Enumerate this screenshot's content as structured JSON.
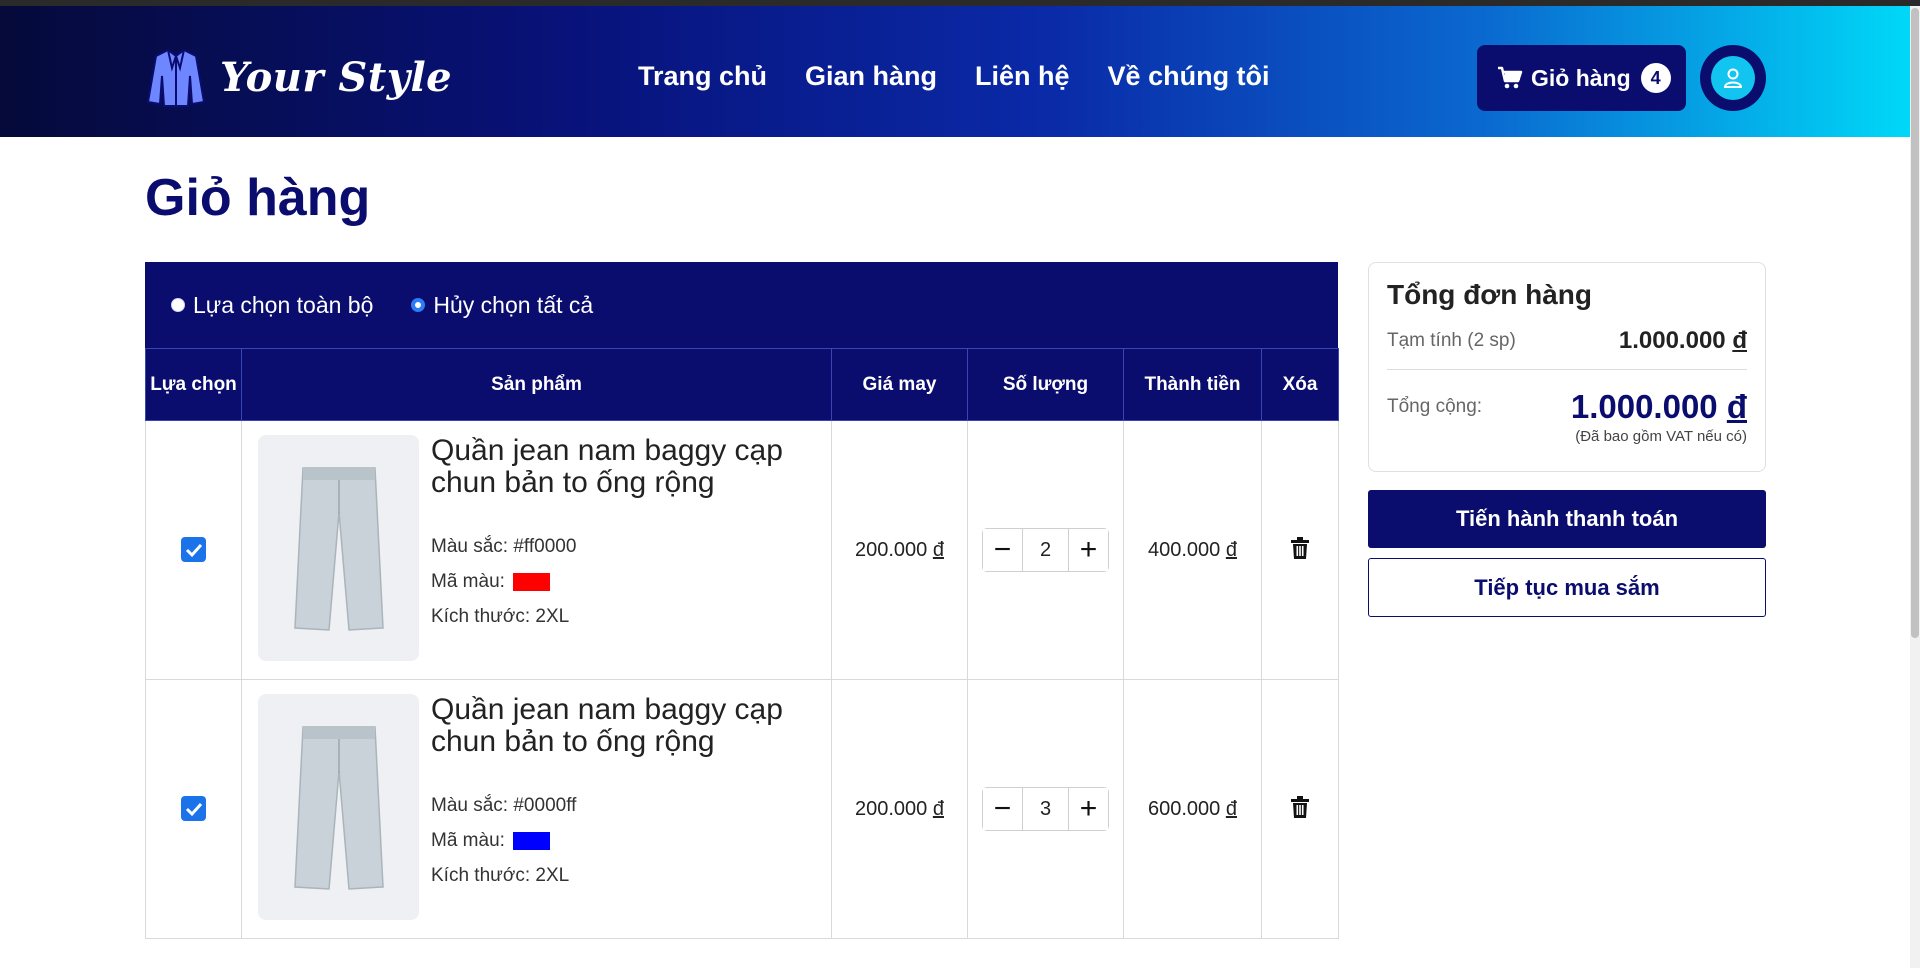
{
  "header": {
    "logo_text": "Your Style",
    "nav": [
      "Trang chủ",
      "Gian hàng",
      "Liên hệ",
      "Về chúng tôi"
    ],
    "cart_label": "Giỏ hàng",
    "cart_count": "4"
  },
  "page": {
    "title": "Giỏ hàng"
  },
  "selection": {
    "select_all": "Lựa chọn toàn bộ",
    "deselect_all": "Hủy chọn tất cả"
  },
  "table": {
    "headers": {
      "select": "Lựa chọn",
      "product": "Sản phẩm",
      "price": "Giá may",
      "qty": "Số lượng",
      "total": "Thành tiền",
      "delete": "Xóa"
    },
    "rows": [
      {
        "checked": true,
        "name": "Quần jean nam baggy cạp chun bản to ống rộng",
        "color_text": "Màu sắc: #ff0000",
        "color_code_label": "Mã màu:",
        "swatch": "#ff0000",
        "size": "Kích thước: 2XL",
        "price": "200.000",
        "quantity": "2",
        "line_total": "400.000"
      },
      {
        "checked": true,
        "name": "Quần jean nam baggy cạp chun bản to ống rộng",
        "color_text": "Màu sắc: #0000ff",
        "color_code_label": "Mã màu:",
        "swatch": "#0000ff",
        "size": "Kích thước: 2XL",
        "price": "200.000",
        "quantity": "3",
        "line_total": "600.000"
      }
    ],
    "currency": "đ"
  },
  "summary": {
    "title": "Tổng đơn hàng",
    "subtotal_label": "Tạm tính (2 sp)",
    "subtotal_value": "1.000.000",
    "total_label": "Tổng cộng:",
    "total_value": "1.000.000",
    "currency": "đ",
    "vat_note": "(Đã bao gồm VAT nếu có)"
  },
  "actions": {
    "checkout": "Tiến hành thanh toán",
    "continue": "Tiếp tục mua sắm"
  },
  "colors": {
    "primary": "#0a0d6e",
    "checkbox": "#1a73e8",
    "avatar": "#12c4f0"
  }
}
